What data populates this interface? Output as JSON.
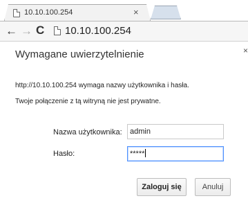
{
  "browser": {
    "tab_title": "10.10.100.254",
    "tab_close": "×",
    "url": "10.10.100.254",
    "icons": {
      "back": "arrow-left-icon",
      "forward": "arrow-right-icon",
      "reload": "reload-icon",
      "page": "document-icon"
    }
  },
  "dialog": {
    "title": "Wymagane uwierzytelnienie",
    "close": "×",
    "message_line1": "http://10.10.100.254 wymaga nazwy użytkownika i hasła.",
    "message_line2": "Twoje połączenie z tą witryną nie jest prywatne.",
    "username_label": "Nazwa użytkownika:",
    "username_value": "admin",
    "password_label": "Hasło:",
    "password_value": "*****",
    "login_button": "Zaloguj się",
    "cancel_button": "Anuluj"
  },
  "colors": {
    "focus_border": "#4d90fe",
    "new_tab": "#d6e0ec"
  }
}
